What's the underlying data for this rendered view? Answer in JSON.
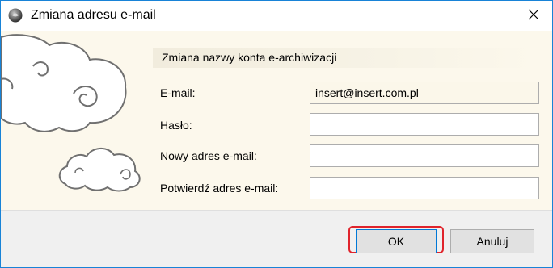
{
  "window": {
    "title": "Zmiana adresu e-mail",
    "close_icon": "close-icon",
    "app_icon": "app-icon"
  },
  "section": {
    "header": "Zmiana nazwy konta e-archiwizacji"
  },
  "fields": {
    "email": {
      "label": "E-mail:",
      "value": "insert@insert.com.pl"
    },
    "password": {
      "label": "Hasło:",
      "value": ""
    },
    "new_email": {
      "label": "Nowy adres e-mail:",
      "value": ""
    },
    "confirm_email": {
      "label": "Potwierdź adres e-mail:",
      "value": ""
    }
  },
  "buttons": {
    "ok": "OK",
    "cancel": "Anuluj"
  },
  "colors": {
    "content_bg": "#fcf8ec",
    "footer_bg": "#f0f0f0",
    "highlight": "#e0242c",
    "window_border": "#1883d7"
  }
}
